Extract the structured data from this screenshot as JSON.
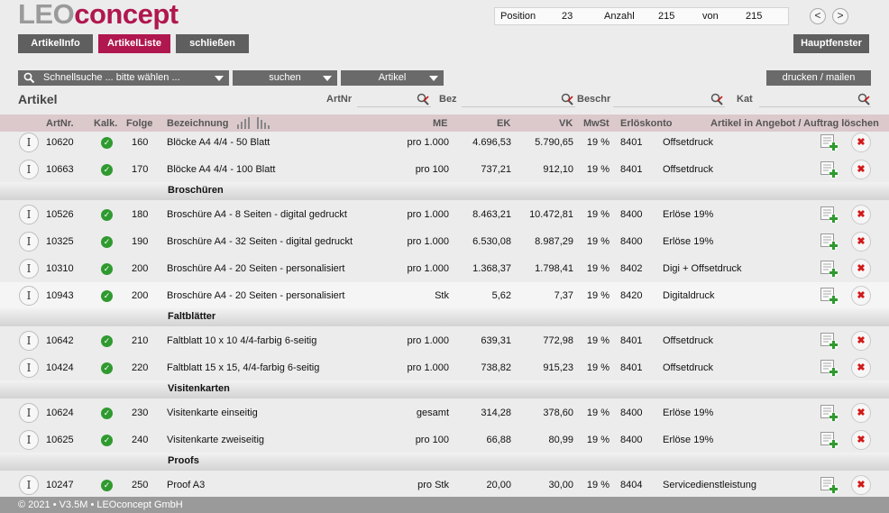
{
  "logo": {
    "part1": "LEO",
    "part2": "concept"
  },
  "position": {
    "label_position": "Position",
    "position": "23",
    "label_anzahl": "Anzahl",
    "anzahl": "215",
    "label_von": "von",
    "von": "215"
  },
  "nav": {
    "prev": "<",
    "next": ">"
  },
  "tabs": [
    {
      "label": "ArtikelInfo"
    },
    {
      "label": "ArtikelListe"
    },
    {
      "label": "schließen"
    }
  ],
  "hauptfenster": "Hauptfenster",
  "toolbar": {
    "quicksearch": "Schnellsuche ... bitte wählen ...",
    "suchen": "suchen",
    "artikel": "Artikel",
    "print": "drucken / mailen"
  },
  "filters": {
    "title": "Artikel",
    "artnr": "ArtNr",
    "bez": "Bez",
    "beschr": "Beschr",
    "kat": "Kat"
  },
  "columns": {
    "artnr": "ArtNr.",
    "kalk": "Kalk.",
    "folge": "Folge",
    "bez": "Bezeichnung",
    "me": "ME",
    "ek": "EK",
    "vk": "VK",
    "mwst": "MwSt",
    "konto": "Erlöskonto",
    "actions": "Artikel in Angebot / Auftrag löschen"
  },
  "rows": [
    {
      "artnr": "10620",
      "folge": "160",
      "bez": "Blöcke A4 4/4 - 50 Blatt",
      "me": "pro 1.000",
      "ek": "4.696,53",
      "vk": "5.790,65",
      "mwst": "19 %",
      "konto": "8401",
      "konto_name": "Offsetdruck"
    },
    {
      "artnr": "10663",
      "folge": "170",
      "bez": "Blöcke A4 4/4 - 100 Blatt",
      "me": "pro 100",
      "ek": "737,21",
      "vk": "912,10",
      "mwst": "19 %",
      "konto": "8401",
      "konto_name": "Offsetdruck"
    },
    {
      "artnr": "10526",
      "folge": "180",
      "bez": "Broschüre A4 - 8 Seiten - digital gedruckt",
      "me": "pro 1.000",
      "ek": "8.463,21",
      "vk": "10.472,81",
      "mwst": "19 %",
      "konto": "8400",
      "konto_name": "Erlöse 19%"
    },
    {
      "artnr": "10325",
      "folge": "190",
      "bez": "Broschüre A4 - 32 Seiten - digital gedruckt",
      "me": "pro 1.000",
      "ek": "6.530,08",
      "vk": "8.987,29",
      "mwst": "19 %",
      "konto": "8400",
      "konto_name": "Erlöse 19%"
    },
    {
      "artnr": "10310",
      "folge": "200",
      "bez": "Broschüre A4 - 20 Seiten - personalisiert",
      "me": "pro 1.000",
      "ek": "1.368,37",
      "vk": "1.798,41",
      "mwst": "19 %",
      "konto": "8402",
      "konto_name": "Digi + Offsetdruck"
    },
    {
      "artnr": "10943",
      "folge": "200",
      "bez": "Broschüre A4 - 20 Seiten - personalisiert",
      "me": "Stk",
      "ek": "5,62",
      "vk": "7,37",
      "mwst": "19 %",
      "konto": "8420",
      "konto_name": "Digitaldruck"
    },
    {
      "artnr": "10642",
      "folge": "210",
      "bez": "Faltblatt 10 x 10 4/4-farbig 6-seitig",
      "me": "pro 1.000",
      "ek": "639,31",
      "vk": "772,98",
      "mwst": "19 %",
      "konto": "8401",
      "konto_name": "Offsetdruck"
    },
    {
      "artnr": "10424",
      "folge": "220",
      "bez": "Faltblatt 15 x 15, 4/4-farbig 6-seitig",
      "me": "pro 1.000",
      "ek": "738,82",
      "vk": "915,23",
      "mwst": "19 %",
      "konto": "8401",
      "konto_name": "Offsetdruck"
    },
    {
      "artnr": "10624",
      "folge": "230",
      "bez": "Visitenkarte einseitig",
      "me": "gesamt",
      "ek": "314,28",
      "vk": "378,60",
      "mwst": "19 %",
      "konto": "8400",
      "konto_name": "Erlöse 19%"
    },
    {
      "artnr": "10625",
      "folge": "240",
      "bez": "Visitenkarte zweiseitig",
      "me": "pro 100",
      "ek": "66,88",
      "vk": "80,99",
      "mwst": "19 %",
      "konto": "8400",
      "konto_name": "Erlöse 19%"
    },
    {
      "artnr": "10247",
      "folge": "250",
      "bez": "Proof A3",
      "me": "pro Stk",
      "ek": "20,00",
      "vk": "30,00",
      "mwst": "19 %",
      "konto": "8404",
      "konto_name": "Servicedienstleistung"
    }
  ],
  "groups": [
    "Broschüren",
    "Faltblätter",
    "Visitenkarten",
    "Proofs"
  ],
  "footer": "© 2021 • V3.5M • LEOconcept GmbH",
  "colors": {
    "brand": "#b0174f",
    "tab": "#5f5f5f",
    "header": "#dcc9cc"
  }
}
